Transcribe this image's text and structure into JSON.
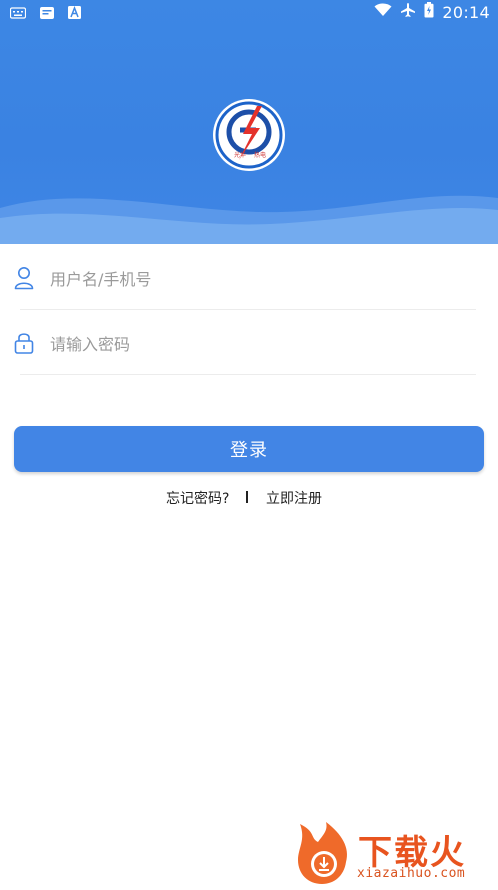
{
  "statusbar": {
    "time": "20:14",
    "left_icons": [
      "keyboard-icon",
      "message-icon",
      "a-icon"
    ],
    "right_icons": [
      "wifi-icon",
      "airplane-icon",
      "battery-icon"
    ]
  },
  "login": {
    "username_placeholder": "用户名/手机号",
    "password_placeholder": "请输入密码",
    "login_label": "登录",
    "forgot_label": "忘记密码?",
    "register_label": "立即注册"
  },
  "logo": {
    "text_left": "光华",
    "text_right": "热电"
  },
  "watermark": {
    "text": "下载火",
    "domain": "xiazaihuo.com"
  },
  "colors": {
    "header": "#3d87e4",
    "button": "#4285e5",
    "watermark": "#e8541f"
  }
}
